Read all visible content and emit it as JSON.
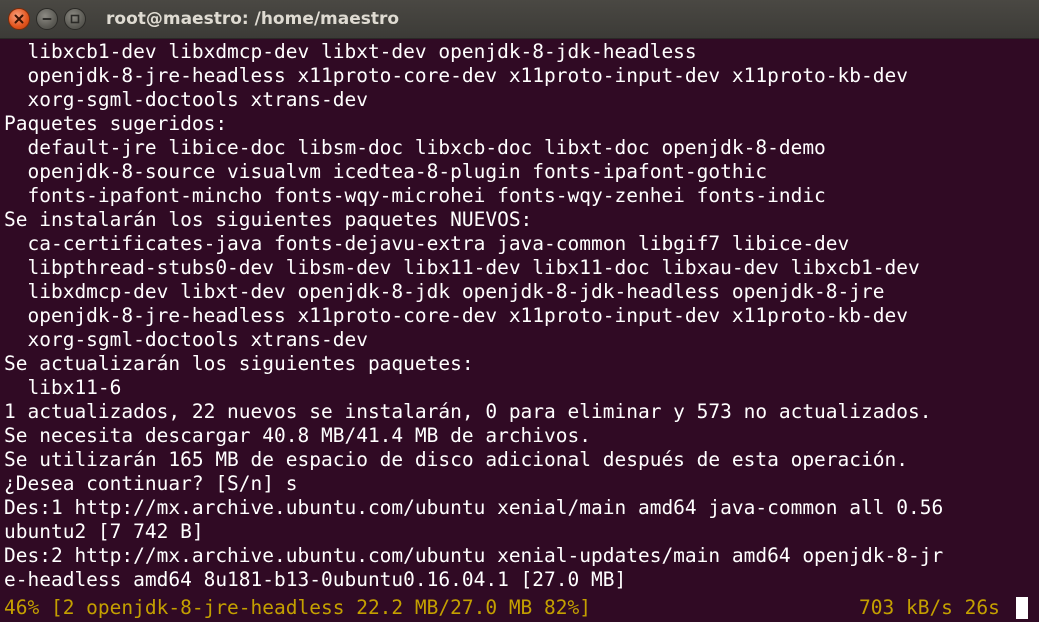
{
  "window": {
    "title": "root@maestro: /home/maestro"
  },
  "terminal": {
    "lines": [
      "  libxcb1-dev libxdmcp-dev libxt-dev openjdk-8-jdk-headless",
      "  openjdk-8-jre-headless x11proto-core-dev x11proto-input-dev x11proto-kb-dev",
      "  xorg-sgml-doctools xtrans-dev",
      "Paquetes sugeridos:",
      "  default-jre libice-doc libsm-doc libxcb-doc libxt-doc openjdk-8-demo",
      "  openjdk-8-source visualvm icedtea-8-plugin fonts-ipafont-gothic",
      "  fonts-ipafont-mincho fonts-wqy-microhei fonts-wqy-zenhei fonts-indic",
      "Se instalarán los siguientes paquetes NUEVOS:",
      "  ca-certificates-java fonts-dejavu-extra java-common libgif7 libice-dev",
      "  libpthread-stubs0-dev libsm-dev libx11-dev libx11-doc libxau-dev libxcb1-dev",
      "  libxdmcp-dev libxt-dev openjdk-8-jdk openjdk-8-jdk-headless openjdk-8-jre",
      "  openjdk-8-jre-headless x11proto-core-dev x11proto-input-dev x11proto-kb-dev",
      "  xorg-sgml-doctools xtrans-dev",
      "Se actualizarán los siguientes paquetes:",
      "  libx11-6",
      "1 actualizados, 22 nuevos se instalarán, 0 para eliminar y 573 no actualizados.",
      "Se necesita descargar 40.8 MB/41.4 MB de archivos.",
      "Se utilizarán 165 MB de espacio de disco adicional después de esta operación.",
      "¿Desea continuar? [S/n] s",
      "Des:1 http://mx.archive.ubuntu.com/ubuntu xenial/main amd64 java-common all 0.56",
      "ubuntu2 [7 742 B]",
      "Des:2 http://mx.archive.ubuntu.com/ubuntu xenial-updates/main amd64 openjdk-8-jr",
      "e-headless amd64 8u181-b13-0ubuntu0.16.04.1 [27.0 MB]"
    ],
    "progress": {
      "status": "46% [2 openjdk-8-jre-headless 22.2 MB/27.0 MB 82%]",
      "rate": "703 kB/s 26s"
    },
    "colors": {
      "background": "#300a24",
      "text": "#ffffff",
      "progress_text": "#c4a000"
    }
  }
}
